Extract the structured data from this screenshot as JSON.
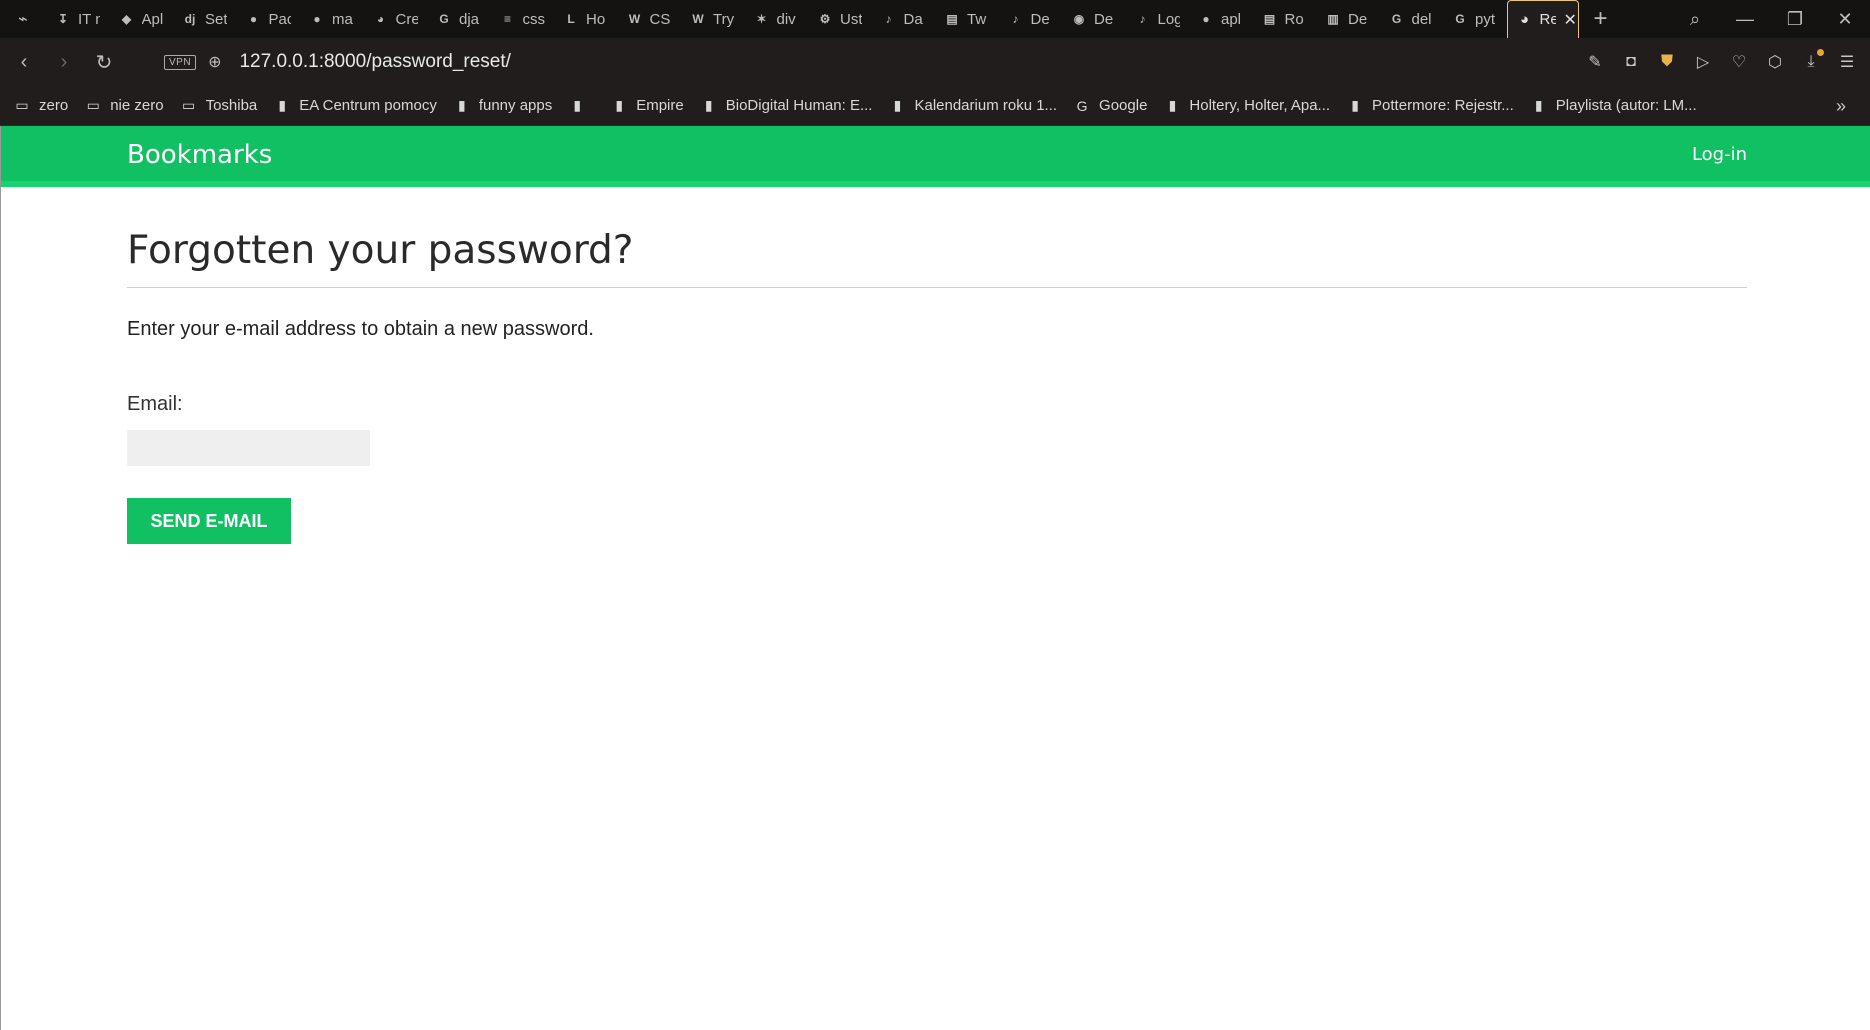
{
  "browser": {
    "tabs": [
      {
        "icon": "game-controller-icon",
        "glyph": "⌁",
        "title": ""
      },
      {
        "icon": "sort-az-icon",
        "glyph": "↧",
        "title": "IT n"
      },
      {
        "icon": "gitlab-icon",
        "glyph": "◆",
        "title": "Apl"
      },
      {
        "icon": "django-icon",
        "glyph": "dj",
        "title": "Set"
      },
      {
        "icon": "github-icon",
        "glyph": "●",
        "title": "Pac"
      },
      {
        "icon": "github-icon",
        "glyph": "●",
        "title": "ma"
      },
      {
        "icon": "globe-icon",
        "glyph": "◕",
        "title": "Cre"
      },
      {
        "icon": "google-icon",
        "glyph": "G",
        "title": "dja"
      },
      {
        "icon": "stackoverflow-icon",
        "glyph": "≡",
        "title": "css"
      },
      {
        "icon": "letter-l-icon",
        "glyph": "L",
        "title": "Ho"
      },
      {
        "icon": "w3schools-icon",
        "glyph": "W",
        "title": "CS"
      },
      {
        "icon": "w3schools-icon",
        "glyph": "W",
        "title": "Try"
      },
      {
        "icon": "sparkle-icon",
        "glyph": "✶",
        "title": "div"
      },
      {
        "icon": "gear-icon",
        "glyph": "⚙",
        "title": "Ust"
      },
      {
        "icon": "music-note-icon",
        "glyph": "♪",
        "title": "Da"
      },
      {
        "icon": "book-icon",
        "glyph": "▤",
        "title": "Tw"
      },
      {
        "icon": "music-note-icon",
        "glyph": "♪",
        "title": "De"
      },
      {
        "icon": "record-icon",
        "glyph": "◉",
        "title": "De"
      },
      {
        "icon": "music-note-icon",
        "glyph": "♪",
        "title": "Log"
      },
      {
        "icon": "github-icon",
        "glyph": "●",
        "title": "apl"
      },
      {
        "icon": "book-icon",
        "glyph": "▤",
        "title": "Ro"
      },
      {
        "icon": "document-icon",
        "glyph": "▥",
        "title": "De"
      },
      {
        "icon": "google-icon",
        "glyph": "G",
        "title": "del"
      },
      {
        "icon": "google-icon",
        "glyph": "G",
        "title": "pyt"
      }
    ],
    "active_tab": {
      "title": "Re",
      "icon": "globe-icon",
      "glyph": "◕"
    },
    "url": "127.0.0.1:8000/password_reset/",
    "vpn_label": "VPN",
    "bookmarks": [
      {
        "icon": "folder-icon",
        "glyph": "▭",
        "label": "zero"
      },
      {
        "icon": "folder-icon",
        "glyph": "▭",
        "label": "nie zero"
      },
      {
        "icon": "folder-icon",
        "glyph": "▭",
        "label": "Toshiba"
      },
      {
        "icon": "page-icon",
        "glyph": "▮",
        "label": "EA Centrum pomocy"
      },
      {
        "icon": "page-icon",
        "glyph": "▮",
        "label": "funny apps"
      },
      {
        "icon": "page-icon",
        "glyph": "▮",
        "label": ""
      },
      {
        "icon": "page-icon",
        "glyph": "▮",
        "label": "Empire"
      },
      {
        "icon": "page-icon",
        "glyph": "▮",
        "label": "BioDigital Human: E..."
      },
      {
        "icon": "page-icon",
        "glyph": "▮",
        "label": "Kalendarium roku 1..."
      },
      {
        "icon": "google-icon",
        "glyph": "G",
        "label": "Google"
      },
      {
        "icon": "page-icon",
        "glyph": "▮",
        "label": "Holtery, Holter, Apa..."
      },
      {
        "icon": "page-icon",
        "glyph": "▮",
        "label": "Pottermore: Rejestr..."
      },
      {
        "icon": "page-icon",
        "glyph": "▮",
        "label": "Playlista (autor: LM..."
      }
    ]
  },
  "site": {
    "logo": "Bookmarks",
    "login_label": "Log-in",
    "accent_color": "#12c064"
  },
  "form": {
    "title": "Forgotten your password?",
    "intro": "Enter your e-mail address to obtain a new password.",
    "email_label": "Email:",
    "email_value": "",
    "submit_label": "SEND E-MAIL"
  }
}
